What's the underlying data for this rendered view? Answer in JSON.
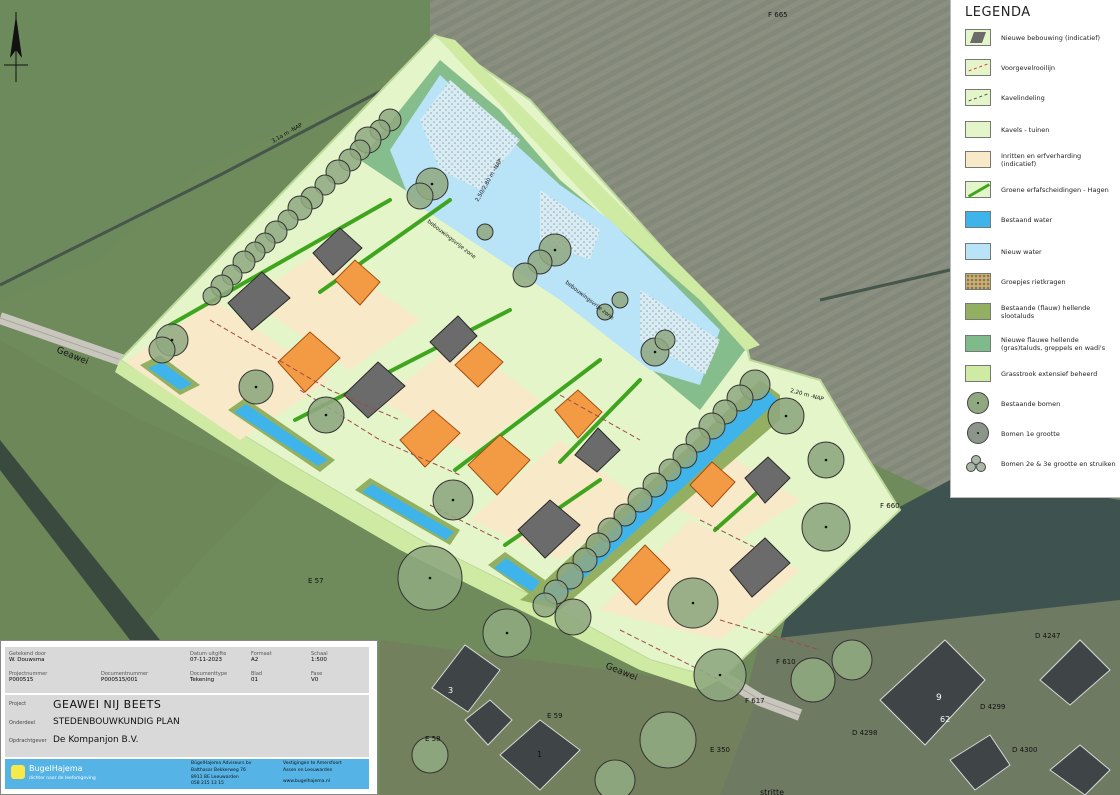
{
  "map": {
    "north_arrow": "north-arrow-icon",
    "labels": {
      "f665": "F 665",
      "f660": "F 660",
      "f610": "F 610",
      "f617": "F 617",
      "e57": "E 57",
      "e59": "E 59",
      "e58": "E 58",
      "e350": "E 350",
      "d4247": "D 4247",
      "d4299": "D 4299",
      "d4298": "D 4298",
      "d4300": "D 4300",
      "geawei1": "Geawei",
      "geawei2": "Geawei",
      "nap1": "3,1a m -NAP",
      "nap2": "2,50/2,80 m -NAP",
      "nap3": "2,20 m -NAP",
      "zone1": "bebouwingsvrije zone",
      "zone2": "bebouwingsvrije zone",
      "house3": "3",
      "house1": "1",
      "house9": "9",
      "house62": "62",
      "street_partial": "stritte"
    }
  },
  "legend": {
    "title": "LEGENDA",
    "items": [
      {
        "label": "Nieuwe bebouwing (indicatief)",
        "icon": "house-swatch",
        "color": "#6b6b6b"
      },
      {
        "label": "Voorgevelrooilijn",
        "icon": "red-dash-line-swatch",
        "color": "#e04040"
      },
      {
        "label": "Kavelindeling",
        "icon": "dash-line-swatch",
        "color": "#555555"
      },
      {
        "label": "Kavels - tuinen",
        "icon": "garden-swatch",
        "color": "#e4f5c9"
      },
      {
        "label": "Inritten en erfverharding (indicatief)",
        "icon": "paving-swatch",
        "color": "#f8e9c8"
      },
      {
        "label": "Groene erfafscheidingen - Hagen",
        "icon": "hedge-swatch",
        "color": "#3fa51e"
      },
      {
        "label": "Bestaand water",
        "icon": "water-swatch",
        "color": "#3fb4ea"
      },
      {
        "label": "Nieuw water",
        "icon": "new-water-swatch",
        "color": "#b9e3f7"
      },
      {
        "label": "Groepjes rietkragen",
        "icon": "reed-swatch",
        "color": "#c8b07a"
      },
      {
        "label": "Bestaande (flauw) hellende slootaluds",
        "icon": "slope-swatch",
        "color": "#93b062"
      },
      {
        "label": "Nieuwe flauwe hellende (gras)taluds, greppels en wadi's",
        "icon": "new-slope-swatch",
        "color": "#7fbb8a"
      },
      {
        "label": "Grasstrook extensief beheerd",
        "icon": "grass-swatch",
        "color": "#cfeaa2"
      },
      {
        "label": "Bestaande bomen",
        "icon": "existing-tree-icon",
        "color": "#8fa880"
      },
      {
        "label": "Bomen 1e grootte",
        "icon": "tree-icon",
        "color": "#8c9589"
      },
      {
        "label": "Bomen 2e & 3e grootte en struiken",
        "icon": "small-trees-icon",
        "color": "#aab7a5"
      }
    ]
  },
  "titleblock": {
    "meta": [
      {
        "key": "Getekend door",
        "value": "W. Douwsma"
      },
      {
        "key": "Datum uitgifte",
        "value": "07-11-2023"
      },
      {
        "key": "Formaat",
        "value": "A2"
      },
      {
        "key": "Schaal",
        "value": "1:500"
      },
      {
        "key": "Projectnummer",
        "value": "P000515"
      },
      {
        "key": "Documentnummer",
        "value": "P000515/001"
      },
      {
        "key": "Documenttype",
        "value": "Tekening"
      },
      {
        "key": "Blad",
        "value": "01"
      },
      {
        "key": "Fase",
        "value": "V0"
      }
    ],
    "project_key": "Project",
    "project": "GEAWEI NIJ BEETS",
    "subject_key": "Onderdeel",
    "subject": "STEDENBOUWKUNDIG PLAN",
    "client_key": "Opdrachtgever",
    "client": "De Kompanjon B.V.",
    "company": "BugelHajema",
    "company_tagline": "dichter naar de leefomgeving",
    "address1": "BügelHajema Adviseurs bv",
    "address2": "Balthasar Bekkerweg 76",
    "address3": "8911 BE Leeuwarden",
    "address4": "058 215 13 15",
    "offices1": "Vestigingen te Amersfoort",
    "offices2": "Assen en Leeuwarden",
    "website": "www.bugelhajema.nl"
  }
}
